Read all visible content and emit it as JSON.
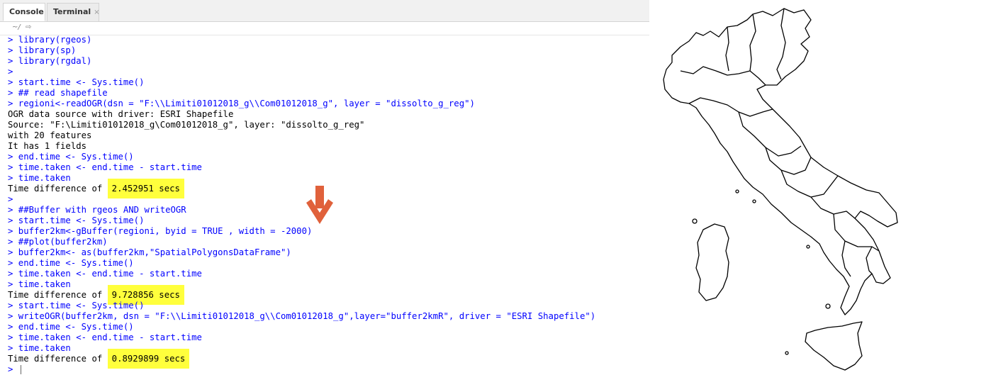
{
  "tabs": {
    "console": "Console",
    "terminal": "Terminal",
    "terminal_close": "×"
  },
  "path": {
    "dir": "~/",
    "arrow": "⇨"
  },
  "console_lines": [
    {
      "type": "in",
      "text": "> library(rgeos)"
    },
    {
      "type": "in",
      "text": "> library(sp)"
    },
    {
      "type": "in",
      "text": "> library(rgdal)"
    },
    {
      "type": "in",
      "text": ">"
    },
    {
      "type": "in",
      "text": "> start.time <- Sys.time()"
    },
    {
      "type": "in",
      "text": "> ## read shapefile"
    },
    {
      "type": "in",
      "text": "> regioni<-readOGR(dsn = \"F:\\\\Limiti01012018_g\\\\Com01012018_g\", layer = \"dissolto_g_reg\")"
    },
    {
      "type": "out",
      "text": "OGR data source with driver: ESRI Shapefile"
    },
    {
      "type": "out",
      "text": "Source: \"F:\\Limiti01012018_g\\Com01012018_g\", layer: \"dissolto_g_reg\""
    },
    {
      "type": "out",
      "text": "with 20 features"
    },
    {
      "type": "out",
      "text": "It has 1 fields"
    },
    {
      "type": "in",
      "text": "> end.time <- Sys.time()"
    },
    {
      "type": "in",
      "text": "> time.taken <- end.time - start.time"
    },
    {
      "type": "in",
      "text": "> time.taken"
    },
    {
      "type": "out",
      "text": "Time difference of ",
      "hl": "2.452951 secs"
    },
    {
      "type": "in",
      "text": ">"
    },
    {
      "type": "in",
      "text": "> ##Buffer with rgeos AND writeOGR"
    },
    {
      "type": "in",
      "text": "> start.time <- Sys.time()"
    },
    {
      "type": "in",
      "text": "> buffer2km<-gBuffer(regioni, byid = TRUE , width = -2000)"
    },
    {
      "type": "in",
      "text": "> ##plot(buffer2km)"
    },
    {
      "type": "in",
      "text": "> buffer2km<- as(buffer2km,\"SpatialPolygonsDataFrame\")"
    },
    {
      "type": "in",
      "text": "> end.time <- Sys.time()"
    },
    {
      "type": "in",
      "text": "> time.taken <- end.time - start.time"
    },
    {
      "type": "in",
      "text": "> time.taken"
    },
    {
      "type": "out",
      "text": "Time difference of ",
      "hl": "9.728856 secs"
    },
    {
      "type": "in",
      "text": "> start.time <- Sys.time()"
    },
    {
      "type": "in",
      "text": "> writeOGR(buffer2km, dsn = \"F:\\\\Limiti01012018_g\\\\Com01012018_g\",layer=\"buffer2kmR\", driver = \"ESRI Shapefile\")"
    },
    {
      "type": "in",
      "text": "> end.time <- Sys.time()"
    },
    {
      "type": "in",
      "text": "> time.taken <- end.time - start.time"
    },
    {
      "type": "in",
      "text": "> time.taken"
    },
    {
      "type": "out",
      "text": "Time difference of ",
      "hl": "0.8929899 secs"
    },
    {
      "type": "prompt",
      "text": "> "
    }
  ],
  "colors": {
    "input": "#0000ff",
    "output": "#000000",
    "highlight": "#ffff3c",
    "arrow": "#e0613b"
  },
  "icons": {
    "annotation": "down-arrow-icon",
    "map": "italy-regions-map"
  }
}
